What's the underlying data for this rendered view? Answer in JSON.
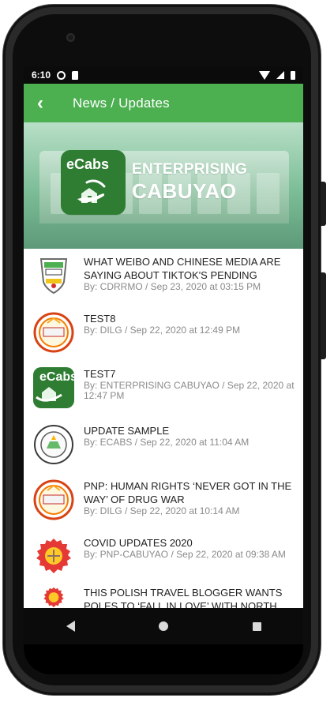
{
  "status_bar": {
    "time": "6:10",
    "icons": [
      "gear-icon",
      "sd-card-icon",
      "wifi-icon",
      "signal-icon",
      "battery-icon"
    ]
  },
  "header": {
    "back_icon": "back-arrow-icon",
    "title": "News / Updates"
  },
  "banner": {
    "logo_text": "eCabs",
    "title_line_1": "ENTERPRISING",
    "title_line_2": "CABUYAO"
  },
  "news_items": [
    {
      "thumbnail": "cdrrmo-logo",
      "title": "WHAT WEIBO AND CHINESE MEDIA ARE SAYING ABOUT TIKTOK'S PENDING",
      "meta": "By: CDRRMO / Sep 23, 2020  at 03:15 PM"
    },
    {
      "thumbnail": "dilg-logo",
      "title": "TEST8",
      "meta": "By: DILG / Sep 22, 2020  at 12:49 PM"
    },
    {
      "thumbnail": "ecabs-logo",
      "title": "TEST7",
      "meta": "By: ENTERPRISING CABUYAO / Sep 22, 2020  at 12:47 PM"
    },
    {
      "thumbnail": "city-seal-logo",
      "title": "UPDATE SAMPLE",
      "meta": "By: ECABS / Sep 22, 2020  at 11:04 AM"
    },
    {
      "thumbnail": "dilg-logo",
      "title": "PNP: HUMAN RIGHTS ‘NEVER GOT IN THE WAY’ OF DRUG WAR",
      "meta": "By: DILG / Sep 22, 2020  at 10:14 AM"
    },
    {
      "thumbnail": "pnp-logo",
      "title": "COVID UPDATES 2020",
      "meta": "By: PNP-CABUYAO / Sep 22, 2020  at 09:38 AM"
    },
    {
      "thumbnail": "pnp-logo",
      "title": "THIS POLISH TRAVEL BLOGGER WANTS POLES TO ‘FALL IN LOVE’ WITH NORTH",
      "meta": ""
    }
  ],
  "navigation": {
    "back_icon": "nav-back-icon",
    "home_icon": "nav-home-icon",
    "recent_icon": "nav-recent-icon"
  },
  "colors": {
    "primary_green": "#4caf50",
    "logo_green": "#2e7d32",
    "text_dark": "#222222",
    "text_meta": "#8a8a8a"
  }
}
